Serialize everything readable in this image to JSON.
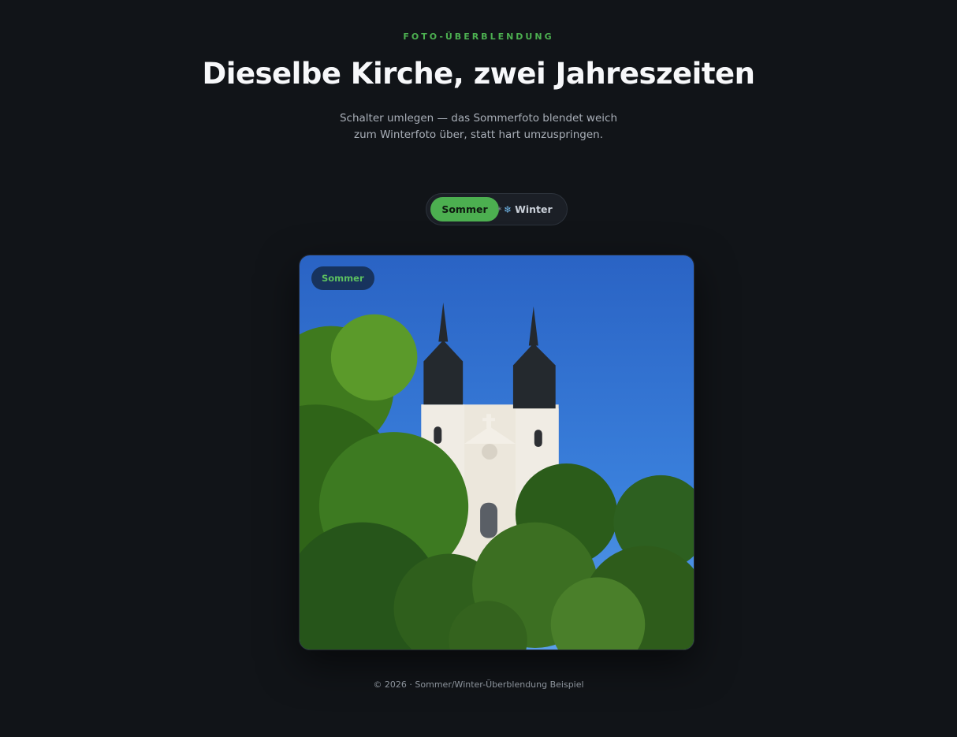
{
  "header": {
    "eyebrow": "FOTO-ÜBERBLENDUNG",
    "title": "Dieselbe Kirche, zwei Jahreszeiten",
    "subtitle_line1": "Schalter umlegen — das Sommerfoto blendet weich",
    "subtitle_line2": "zum Winterfoto über, statt hart umzuspringen."
  },
  "toggle": {
    "summer_label": "Sommer",
    "winter_label": "Winter",
    "winter_icon": "snowflake-icon",
    "selected": "Sommer"
  },
  "photo": {
    "badge": "Sommer",
    "description_icon": "church-photo"
  },
  "footer": {
    "text": "© 2026 · Sommer/Winter-Überblendung Beispiel"
  },
  "colors": {
    "background": "#111418",
    "accent": "#4caf50",
    "sky": "#2f6fd0"
  }
}
